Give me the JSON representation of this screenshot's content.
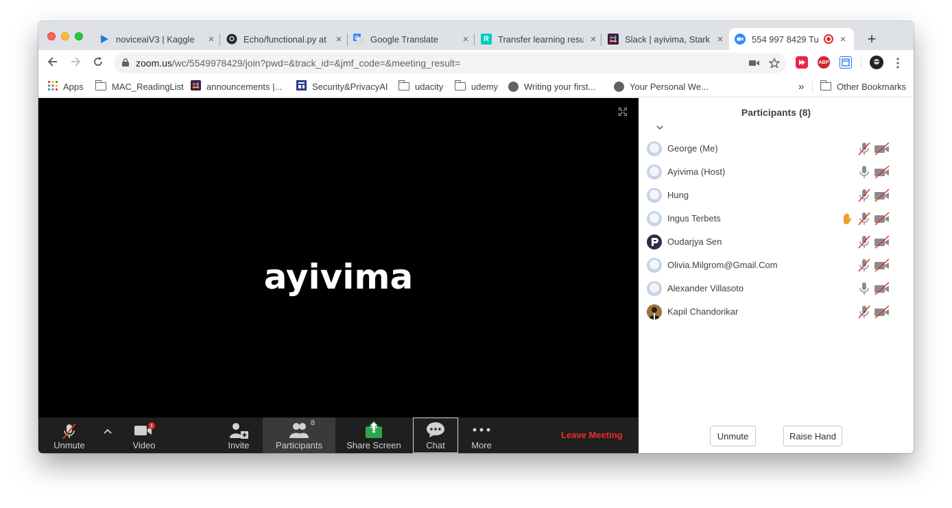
{
  "tabs": [
    {
      "title": "noviceaiV3 | Kaggle",
      "favicon": "kaggle-icon"
    },
    {
      "title": "Echo/functional.py at",
      "favicon": "github-icon"
    },
    {
      "title": "Google Translate",
      "favicon": "google-translate-icon"
    },
    {
      "title": "Transfer learning resu",
      "favicon": "researchgate-icon"
    },
    {
      "title": "Slack | ayivima, Stark",
      "favicon": "slack-icon"
    },
    {
      "title": "554 997 8429 Tu",
      "favicon": "zoom-icon",
      "active": true,
      "recording": true
    }
  ],
  "address_bar": {
    "domain": "zoom.us",
    "path": "/wc/5549978429/join?pwd=&track_id=&jmf_code=&meeting_result="
  },
  "extensions": {
    "abp_label": "ABP"
  },
  "bookmarks": [
    {
      "label": "Apps",
      "icon": "apps-grid-icon"
    },
    {
      "label": "MAC_ReadingList",
      "icon": "folder-icon"
    },
    {
      "label": "announcements |...",
      "icon": "slack-icon"
    },
    {
      "label": "Security&PrivacyAI",
      "icon": "site-icon"
    },
    {
      "label": "udacity",
      "icon": "folder-icon"
    },
    {
      "label": "udemy",
      "icon": "folder-icon"
    },
    {
      "label": "Writing your first...",
      "icon": "globe-icon"
    },
    {
      "label": "Your Personal We...",
      "icon": "globe-icon"
    }
  ],
  "bookmarks_overflow": "»",
  "other_bookmarks": "Other Bookmarks",
  "meeting": {
    "active_speaker": "ayivima"
  },
  "controls": {
    "unmute": "Unmute",
    "video": "Video",
    "video_badge": "!",
    "invite": "Invite",
    "participants": "Participants",
    "participants_count": "8",
    "share_screen": "Share Screen",
    "chat": "Chat",
    "more": "More",
    "leave": "Leave Meeting"
  },
  "panel": {
    "title": "Participants (8)",
    "collapse_icon": "chevron-down-icon",
    "participants": [
      {
        "name": "George (Me)",
        "mic": "muted",
        "video": "off",
        "avatar": "default"
      },
      {
        "name": "Ayivima (Host)",
        "mic": "on",
        "video": "off",
        "avatar": "default"
      },
      {
        "name": "Hung",
        "mic": "muted",
        "video": "off",
        "avatar": "default"
      },
      {
        "name": "Ingus Terbets",
        "mic": "muted",
        "video": "off",
        "avatar": "default",
        "hand_raised": true
      },
      {
        "name": "Oudarjya Sen",
        "mic": "muted",
        "video": "off",
        "avatar": "letter-p"
      },
      {
        "name": "Olivia.Milgrom@Gmail.Com",
        "mic": "muted",
        "video": "off",
        "avatar": "default"
      },
      {
        "name": "Alexander Villasoto",
        "mic": "on",
        "video": "off",
        "avatar": "default"
      },
      {
        "name": "Kapil Chandorikar",
        "mic": "muted",
        "video": "off",
        "avatar": "photo"
      }
    ],
    "unmute_button": "Unmute",
    "raise_hand_button": "Raise Hand"
  },
  "colors": {
    "leave_red": "#ed2b2b",
    "share_green": "#2da44e",
    "hand_orange": "#f0a030",
    "mute_slash_red": "#d93025"
  }
}
